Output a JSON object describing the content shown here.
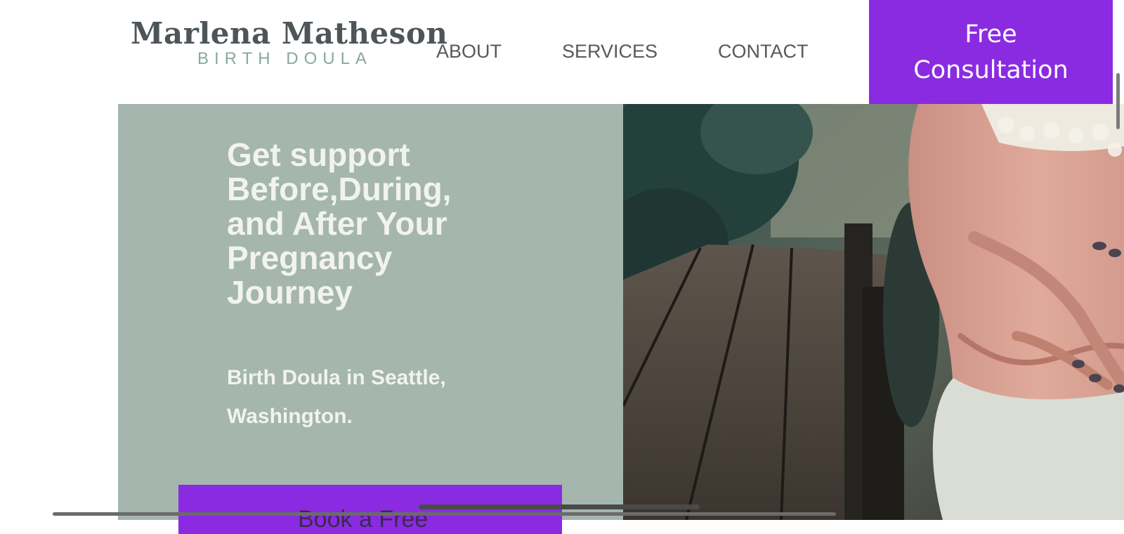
{
  "brand": {
    "name": "Marlena Matheson",
    "subtitle": "BIRTH DOULA"
  },
  "nav": {
    "items": [
      {
        "label": "ABOUT"
      },
      {
        "label": "SERVICES"
      },
      {
        "label": "CONTACT"
      }
    ],
    "cta_label": "Free Consultation"
  },
  "hero": {
    "title": "Get support Before,During, and After Your Pregnancy Journey",
    "subtitle": "Birth Doula in Seattle, Washington.",
    "button_label": "Book a Free"
  },
  "colors": {
    "accent": "#8a2be2",
    "hero_panel": "#a4b6ae",
    "hero_text": "#f2f3ee",
    "logo_text": "#4e5558",
    "logo_subtitle": "#8aa7a0"
  }
}
